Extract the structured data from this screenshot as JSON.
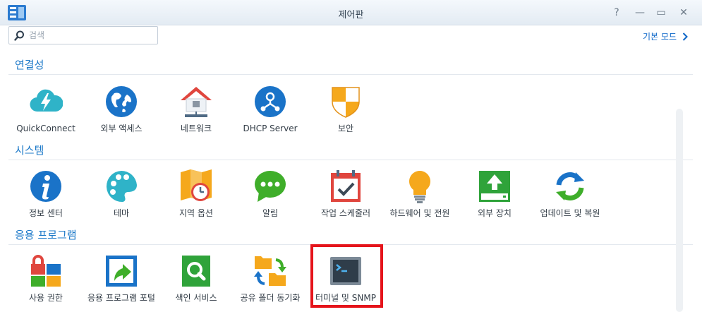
{
  "window": {
    "title": "제어판",
    "help_glyph": "?",
    "minimize_glyph": "—",
    "maximize_glyph": "▭",
    "close_glyph": "✕"
  },
  "toolbar": {
    "search_placeholder": "검색",
    "mode_link": "기본 모드"
  },
  "sections": [
    {
      "title": "연결성",
      "items": [
        {
          "label": "QuickConnect",
          "icon": "quickconnect-icon"
        },
        {
          "label": "외부 액세스",
          "icon": "globe-icon"
        },
        {
          "label": "네트워크",
          "icon": "network-house-icon"
        },
        {
          "label": "DHCP Server",
          "icon": "dhcp-icon"
        },
        {
          "label": "보안",
          "icon": "shield-icon"
        }
      ]
    },
    {
      "title": "시스템",
      "items": [
        {
          "label": "정보 센터",
          "icon": "info-icon"
        },
        {
          "label": "테마",
          "icon": "palette-icon"
        },
        {
          "label": "지역 옵션",
          "icon": "map-clock-icon"
        },
        {
          "label": "알림",
          "icon": "chat-bubble-icon"
        },
        {
          "label": "작업 스케줄러",
          "icon": "calendar-check-icon"
        },
        {
          "label": "하드웨어 및 전원",
          "icon": "lightbulb-icon"
        },
        {
          "label": "외부 장치",
          "icon": "upload-device-icon"
        },
        {
          "label": "업데이트 및 복원",
          "icon": "refresh-icon"
        }
      ]
    },
    {
      "title": "응용 프로그램",
      "items": [
        {
          "label": "사용 권한",
          "icon": "privileges-icon"
        },
        {
          "label": "응용 프로그램 포털",
          "icon": "portal-arrow-icon"
        },
        {
          "label": "색인 서비스",
          "icon": "index-search-icon"
        },
        {
          "label": "공유 폴더 동기화",
          "icon": "folder-sync-icon"
        },
        {
          "label": "터미널 및 SNMP",
          "icon": "terminal-icon"
        }
      ]
    }
  ],
  "colors": {
    "accent": "#1b78c8",
    "highlight": "#e5141b"
  }
}
